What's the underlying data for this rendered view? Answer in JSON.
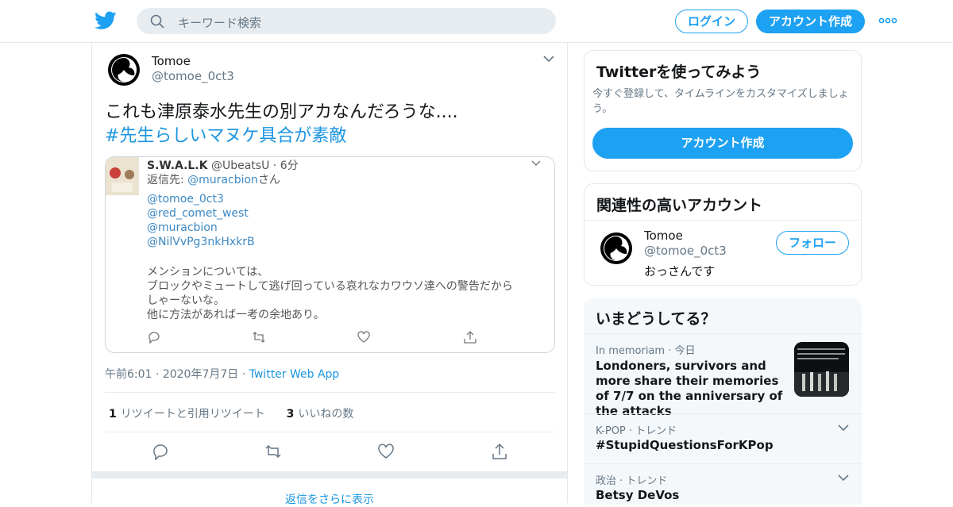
{
  "header": {
    "search_placeholder": "キーワード検索",
    "login_label": "ログイン",
    "signup_label": "アカウント作成"
  },
  "tweet": {
    "name": "Tomoe",
    "handle": "@tomoe_0ct3",
    "text_line1": "これも津原泰水先生の別アカなんだろうな....",
    "hashtag": "#先生らしいマヌケ具合が素敵",
    "quote": {
      "name": "S.W.A.L.K",
      "handle_time": "@UbeatsU · 6分",
      "reply_prefix": "返信先: ",
      "reply_to": "@muracbion",
      "reply_suffix": "さん",
      "mentions": [
        "@tomoe_0ct3",
        "@red_comet_west",
        "@muracbion",
        "@NilVvPg3nkHxkrB"
      ],
      "body": [
        "メンションについては、",
        "ブロックやミュートして逃げ回っている哀れなカワウソ達への警告だから",
        "しゃーないな。",
        "他に方法があれば一考の余地あり。"
      ]
    },
    "time": "午前6:01",
    "date": "2020年7月7日",
    "app": "Twitter Web App",
    "retweets_count": "1",
    "retweets_label": "リツイートと引用リツイート",
    "likes_count": "3",
    "likes_label": "いいねの数",
    "more_replies": "返信をさらに表示"
  },
  "sidebar": {
    "signup_card": {
      "title": "Twitterを使ってみよう",
      "desc": "今すぐ登録して、タイムラインをカスタマイズしましょう。",
      "button": "アカウント作成"
    },
    "related": {
      "title": "関連性の高いアカウント",
      "name": "Tomoe",
      "handle": "@tomoe_0ct3",
      "bio": "おっさんです",
      "follow_label": "フォロー"
    },
    "trends": {
      "title": "いまどうしてる？",
      "items": [
        {
          "context": "In memoriam · 今日",
          "title": "Londoners, survivors and more share their memories of 7/7 on the anniversary of the attacks"
        },
        {
          "context": "K-POP · トレンド",
          "title": "#StupidQuestionsForKPop"
        },
        {
          "context": "政治 · トレンド",
          "title": "Betsy DeVos"
        }
      ]
    }
  },
  "colors": {
    "accent": "#1da1f2",
    "link": "#1b95e0",
    "secondary": "#657786"
  }
}
